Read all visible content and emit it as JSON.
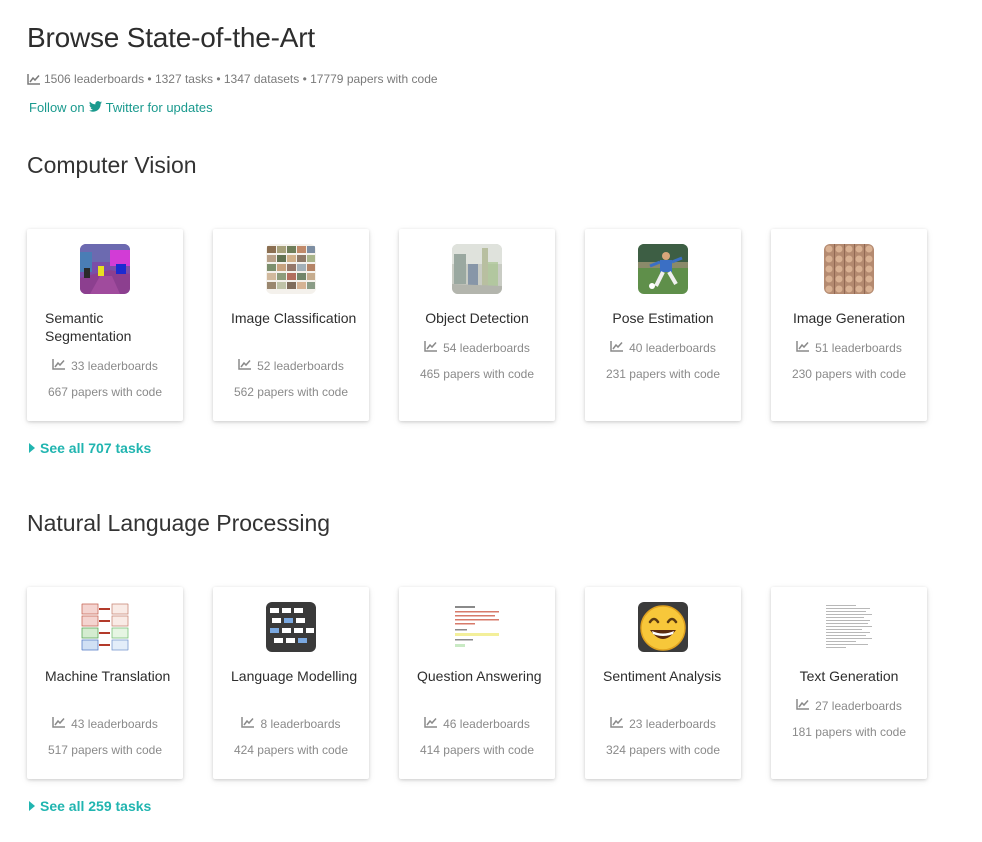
{
  "header": {
    "title": "Browse State-of-the-Art",
    "stats": "1506 leaderboards • 1327 tasks • 1347 datasets • 17779 papers with code",
    "follow_prefix": "Follow on",
    "follow_link": "Twitter for updates"
  },
  "colors": {
    "accent": "#21b5b0",
    "link": "#1a9a8e",
    "muted": "#8a8a8a"
  },
  "sections": [
    {
      "title": "Computer Vision",
      "see_all": "See all 707 tasks",
      "cards": [
        {
          "title": "Semantic Segmentation",
          "leaderboards": "33 leaderboards",
          "papers": "667 papers with code",
          "icon": "segmentation-thumbnail"
        },
        {
          "title": "Image Classification",
          "leaderboards": "52 leaderboards",
          "papers": "562 papers with code",
          "icon": "image-grid-thumbnail"
        },
        {
          "title": "Object Detection",
          "leaderboards": "54 leaderboards",
          "papers": "465 papers with code",
          "icon": "street-scene-thumbnail"
        },
        {
          "title": "Pose Estimation",
          "leaderboards": "40 leaderboards",
          "papers": "231 papers with code",
          "icon": "soccer-player-thumbnail"
        },
        {
          "title": "Image Generation",
          "leaderboards": "51 leaderboards",
          "papers": "230 papers with code",
          "icon": "faces-grid-thumbnail"
        }
      ]
    },
    {
      "title": "Natural Language Processing",
      "see_all": "See all 259 tasks",
      "cards": [
        {
          "title": "Machine Translation",
          "leaderboards": "43 leaderboards",
          "papers": "517 papers with code",
          "icon": "translation-diagram-thumbnail"
        },
        {
          "title": "Language Modelling",
          "leaderboards": "8 leaderboards",
          "papers": "424 papers with code",
          "icon": "token-blocks-thumbnail"
        },
        {
          "title": "Question Answering",
          "leaderboards": "46 leaderboards",
          "papers": "414 papers with code",
          "icon": "qa-document-thumbnail"
        },
        {
          "title": "Sentiment Analysis",
          "leaderboards": "23 leaderboards",
          "papers": "324 papers with code",
          "icon": "smiley-face-thumbnail"
        },
        {
          "title": "Text Generation",
          "leaderboards": "27 leaderboards",
          "papers": "181 papers with code",
          "icon": "text-document-thumbnail"
        }
      ]
    }
  ]
}
